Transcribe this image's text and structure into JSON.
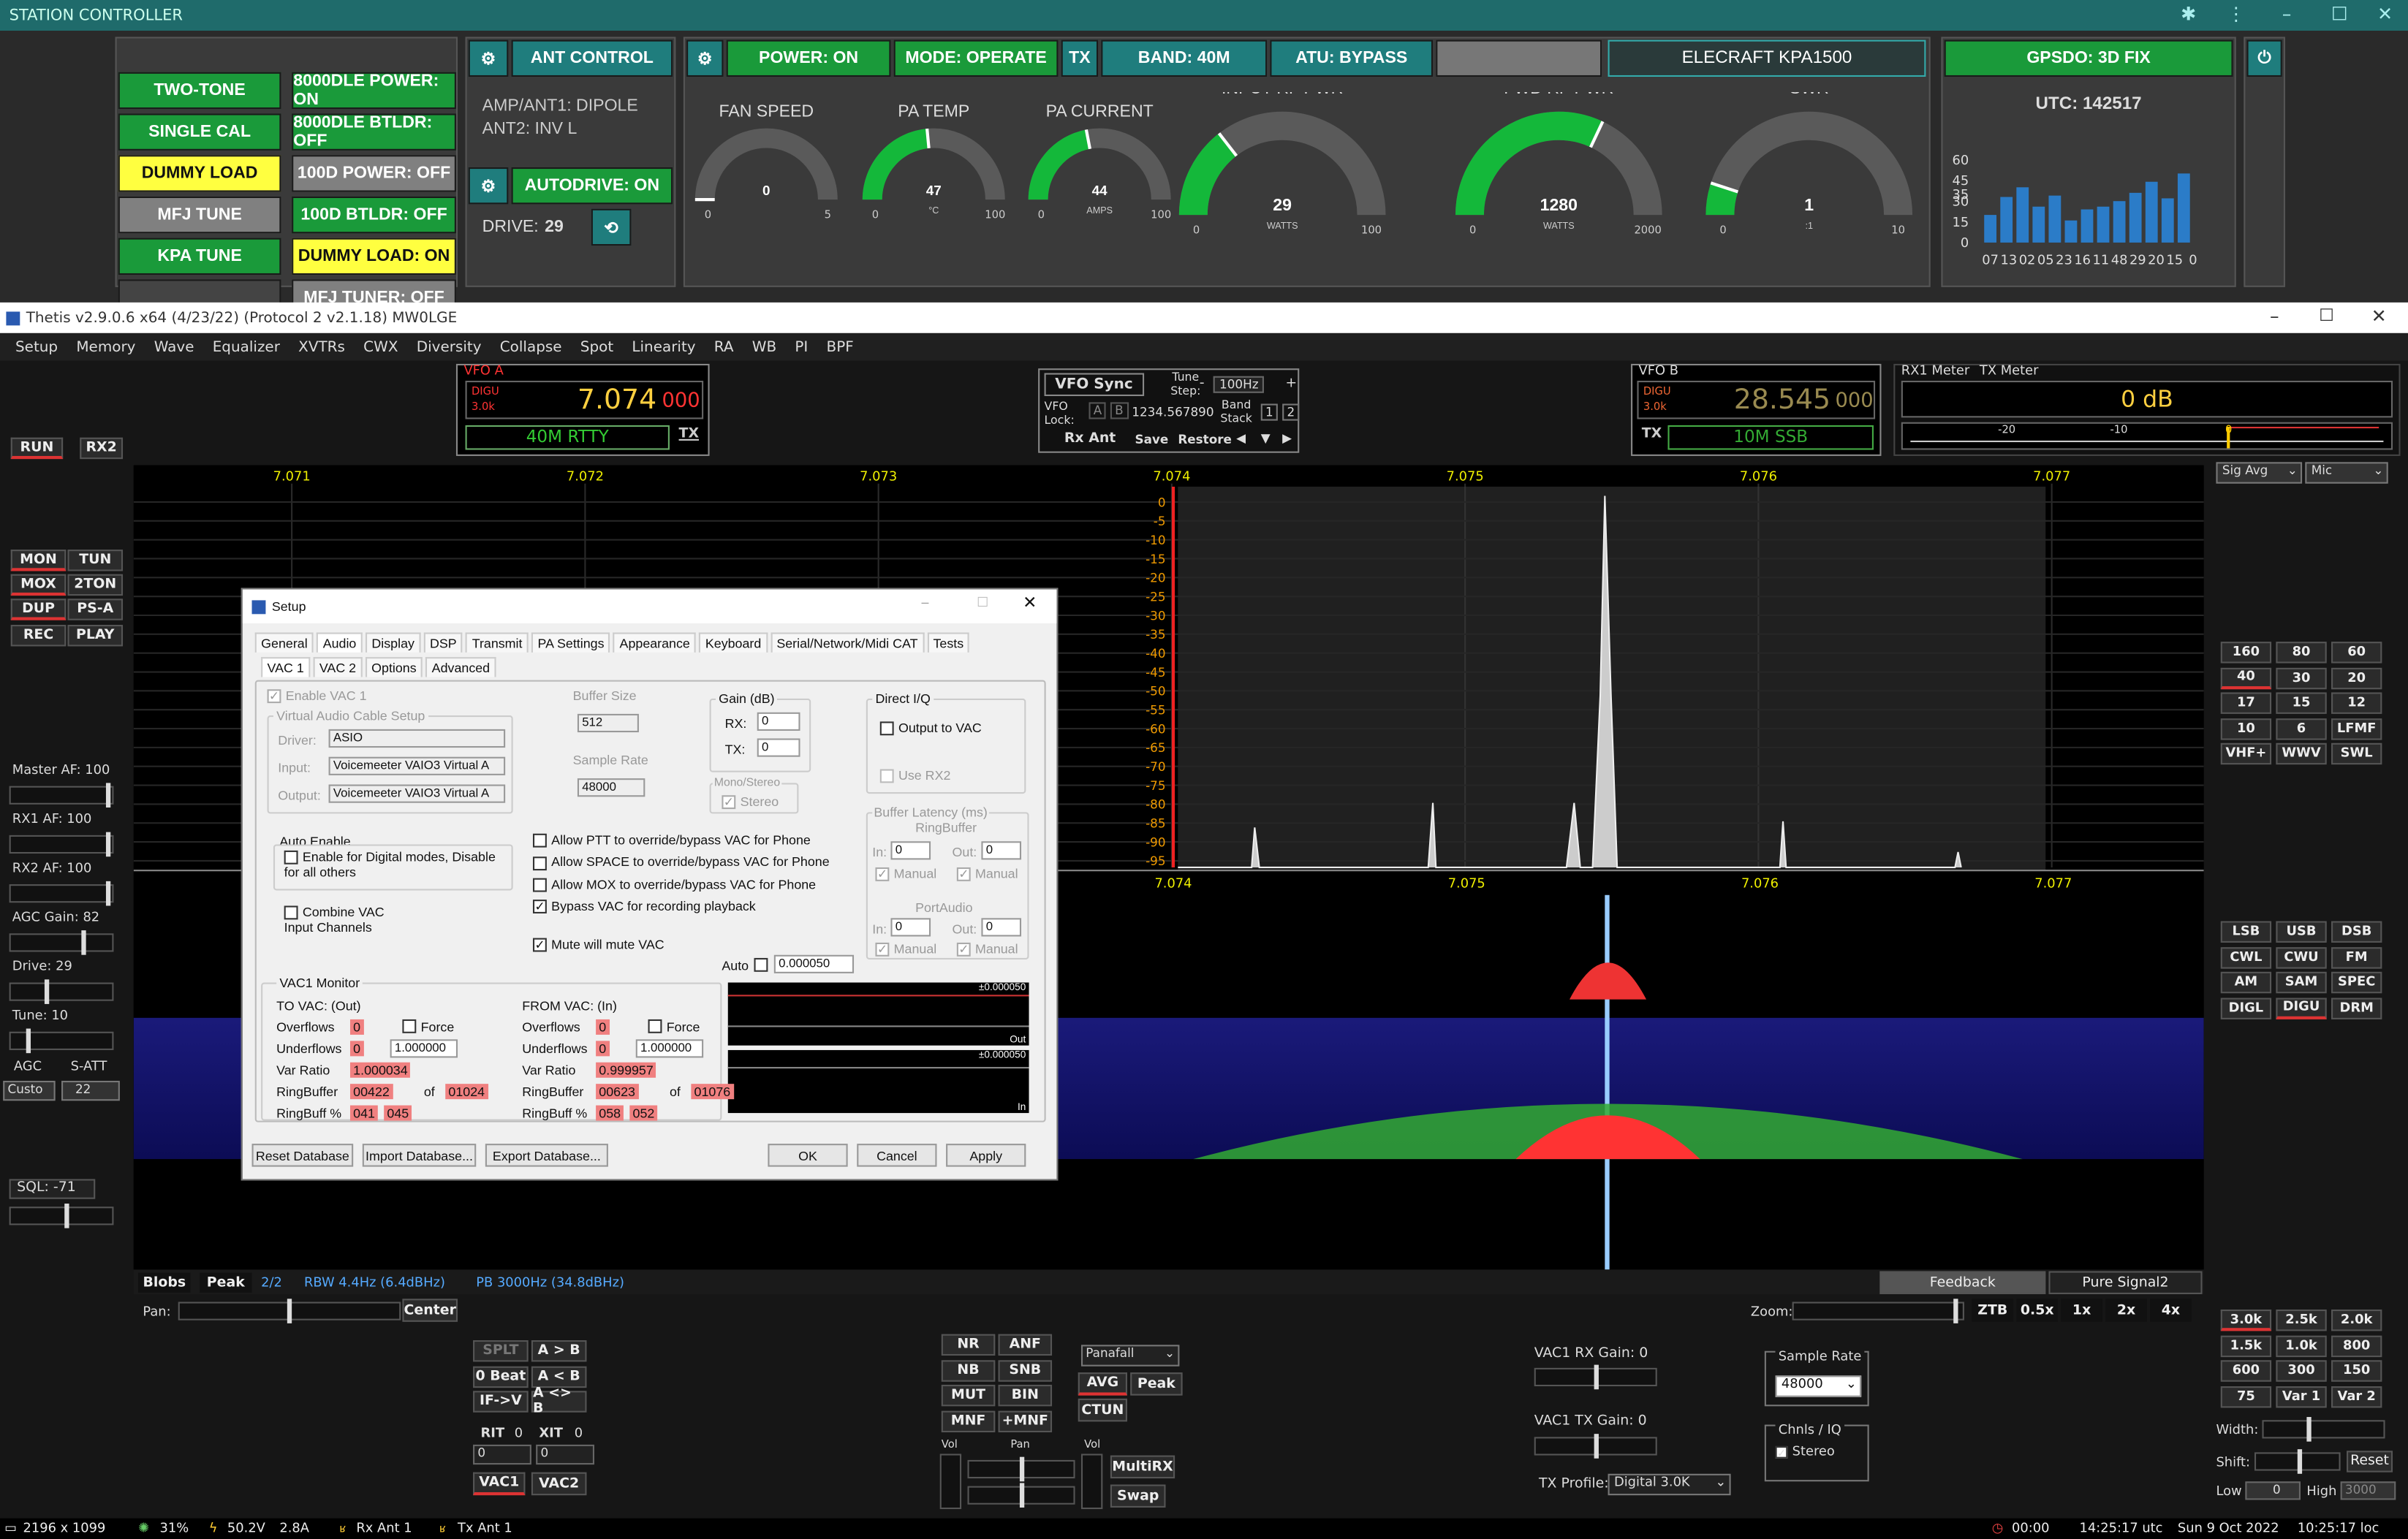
{
  "station_controller": {
    "title": "STATION CONTROLLER",
    "col1": [
      {
        "label": "TWO-TONE",
        "style": "green"
      },
      {
        "label": "SINGLE CAL",
        "style": "green"
      },
      {
        "label": "DUMMY LOAD",
        "style": "yellow"
      },
      {
        "label": "MFJ TUNE",
        "style": "grey"
      },
      {
        "label": "KPA TUNE",
        "style": "green"
      }
    ],
    "col2": [
      {
        "label": "8000DLE POWER: ON",
        "style": "green"
      },
      {
        "label": "8000DLE BTLDR: OFF",
        "style": "green"
      },
      {
        "label": "100D POWER: OFF",
        "style": "grey"
      },
      {
        "label": "100D BTLDR: OFF",
        "style": "green"
      },
      {
        "label": "DUMMY LOAD: ON",
        "style": "yellow"
      },
      {
        "label": "MFJ TUNER: OFF",
        "style": "grey"
      }
    ],
    "ant_control": "ANT CONTROL",
    "ant_lines": [
      "AMP/ANT1: DIPOLE",
      "ANT2: INV L"
    ],
    "autodrive": "AUTODRIVE: ON",
    "drive_label": "DRIVE:",
    "drive_value": "29",
    "top_status": [
      "POWER: ON",
      "MODE: OPERATE",
      "TX",
      "BAND: 40M",
      "ATU: BYPASS"
    ],
    "amp_name": "ELECRAFT KPA1500",
    "gpsdo": "GPSDO: 3D FIX",
    "utc": "UTC: 142517",
    "gauges": [
      {
        "title": "FAN SPEED",
        "value": "0",
        "min": "0",
        "max": "5",
        "unit": "",
        "frac": 0.0
      },
      {
        "title": "PA TEMP",
        "value": "47",
        "min": "0",
        "max": "100",
        "unit": "°C",
        "frac": 0.47
      },
      {
        "title": "PA CURRENT",
        "value": "44",
        "min": "0",
        "max": "100",
        "unit": "AMPS",
        "frac": 0.44
      },
      {
        "title": "INPUT RF PWR",
        "value": "29",
        "min": "0",
        "max": "100",
        "unit": "WATTS",
        "frac": 0.29
      },
      {
        "title": "FWD RF PWR",
        "value": "1280",
        "min": "0",
        "max": "2000",
        "unit": "WATTS",
        "frac": 0.64
      },
      {
        "title": "SWR",
        "value": "1",
        "min": "0",
        "max": "10",
        "unit": ":1",
        "frac": 0.1
      }
    ],
    "gps_chart": {
      "y_ticks": [
        "60",
        "45",
        "35",
        "30",
        "15",
        "0"
      ],
      "x_labels": [
        "07",
        "13",
        "02",
        "05",
        "23",
        "16",
        "11",
        "48",
        "29",
        "20",
        "15",
        "0"
      ],
      "values": [
        20,
        33,
        40,
        26,
        34,
        16,
        24,
        26,
        30,
        36,
        44,
        32,
        50
      ]
    }
  },
  "thetis": {
    "title": "Thetis v2.9.0.6 x64 (4/23/22) (Protocol 2 v2.1.18) MW0LGE",
    "menu": [
      "Setup",
      "Memory",
      "Wave",
      "Equalizer",
      "XVTRs",
      "CWX",
      "Diversity",
      "Collapse",
      "Spot",
      "Linearity",
      "RA",
      "WB",
      "PI",
      "BPF"
    ],
    "vfo_a": {
      "label": "VFO A",
      "mode": "DIGU",
      "bw": "3.0k",
      "freq": "7.074",
      "freq_sub": "000",
      "band": "40M RTTY",
      "tx": "TX"
    },
    "vfo_b": {
      "label": "VFO B",
      "mode": "DIGU",
      "bw": "3.0k",
      "freq": "28.545",
      "freq_sub": "000",
      "band": "10M SSB",
      "tx": "TX"
    },
    "vfo_sync": "VFO Sync",
    "tune_step_label": "Tune Step:",
    "tune_step": "100Hz",
    "vfo_lock": "VFO Lock:",
    "lock_value": "1234.567890",
    "band_stack": "Band Stack",
    "rx_ant": "Rx Ant",
    "save": "Save",
    "restore": "Restore",
    "rx1_meter": "RX1 Meter",
    "tx_meter": "TX Meter",
    "meter_value": "0 dB",
    "meter_ticks": [
      "-20",
      "-10",
      "0"
    ],
    "sig_avg": "Sig Avg",
    "mic": "Mic",
    "left_buttons": [
      "RUN",
      "RX2",
      "MON",
      "TUN",
      "MOX",
      "2TON",
      "DUP",
      "PS-A",
      "REC",
      "PLAY"
    ],
    "left_sliders": [
      {
        "label": "Master AF:  100"
      },
      {
        "label": "RX1 AF:  100"
      },
      {
        "label": "RX2 AF:  100"
      },
      {
        "label": "AGC Gain:  82"
      },
      {
        "label": "Drive:  29"
      },
      {
        "label": "Tune:  10"
      }
    ],
    "agc": "AGC",
    "s_att": "S-ATT",
    "agc_mode": "Custo",
    "s_att_value": "22",
    "sql": "SQL: -71",
    "freq_ticks_top": [
      "7.071",
      "7.072",
      "7.073",
      "7.074",
      "7.075",
      "7.076",
      "7.077"
    ],
    "db_ticks": [
      "0",
      "-5",
      "-10",
      "-15",
      "-20",
      "-25",
      "-30",
      "-35",
      "-40",
      "-45",
      "-50",
      "-55",
      "-60",
      "-65",
      "-70",
      "-75",
      "-80",
      "-85",
      "-90",
      "-95"
    ],
    "freq_ticks_mid": [
      "7.074",
      "7.075",
      "7.076",
      "7.077"
    ],
    "bands": [
      "160",
      "80",
      "60",
      "40",
      "30",
      "20",
      "17",
      "15",
      "12",
      "10",
      "6",
      "LFMF",
      "VHF+",
      "WWV",
      "SWL"
    ],
    "modes": [
      "LSB",
      "USB",
      "DSB",
      "CWL",
      "CWU",
      "FM",
      "AM",
      "SAM",
      "SPEC",
      "DIGL",
      "DIGU",
      "DRM"
    ],
    "filters": [
      "3.0k",
      "2.5k",
      "2.0k",
      "1.5k",
      "1.0k",
      "800",
      "600",
      "300",
      "150",
      "75",
      "Var 1",
      "Var 2"
    ],
    "blobs": "Blobs",
    "peak": "Peak",
    "page": "2/2",
    "rbw": "RBW 4.4Hz (6.4dBHz)",
    "pb": "PB 3000Hz (34.8dBHz)",
    "feedback": "Feedback",
    "pure_signal": "Pure Signal2",
    "pan": "Pan:",
    "center": "Center",
    "zoom": "Zoom:",
    "zoom_buttons": [
      "ZTB",
      "0.5x",
      "1x",
      "2x",
      "4x"
    ],
    "split_buttons": [
      "SPLT",
      "A > B",
      "0 Beat",
      "A < B",
      "IF->V",
      "A <> B"
    ],
    "rit": "RIT",
    "rit_v": "0",
    "xit": "XIT",
    "xit_v": "0",
    "rit_field": "0",
    "xit_field": "0",
    "vac1": "VAC1",
    "vac2": "VAC2",
    "dsp_buttons": [
      "NR",
      "ANF",
      "NB",
      "SNB",
      "MUT",
      "BIN",
      "MNF",
      "+MNF"
    ],
    "panafall": "Panafall",
    "avg": "AVG",
    "peak2": "Peak",
    "ctun": "CTUN",
    "vol": "Vol",
    "pan2": "Pan",
    "vol2": "Vol",
    "multirx": "MultiRX",
    "swap": "Swap",
    "vac1_rx_gain": "VAC1 RX Gain:  0",
    "vac1_tx_gain": "VAC1 TX Gain:  0",
    "tx_profile_label": "TX Profile:",
    "tx_profile": "Digital 3.0K",
    "sample_rate_label": "Sample Rate",
    "sample_rate": "48000",
    "chnls_label": "Chnls / IQ",
    "stereo": "Stereo",
    "width": "Width:",
    "shift": "Shift:",
    "reset": "Reset",
    "low": "Low",
    "low_v": "0",
    "high": "High",
    "high_v": "3000"
  },
  "setup": {
    "title": "Setup",
    "tabs": [
      "General",
      "Audio",
      "Display",
      "DSP",
      "Transmit",
      "PA Settings",
      "Appearance",
      "Keyboard",
      "Serial/Network/Midi CAT",
      "Tests"
    ],
    "subtabs": [
      "VAC 1",
      "VAC 2",
      "Options",
      "Advanced"
    ],
    "enable_vac1": "Enable VAC 1",
    "vac_setup": "Virtual Audio Cable Setup",
    "driver_label": "Driver:",
    "driver": "ASIO",
    "input_label": "Input:",
    "input": "Voicemeeter VAIO3 Virtual A",
    "output_label": "Output:",
    "output": "Voicemeeter VAIO3 Virtual A",
    "buffer_size_label": "Buffer Size",
    "buffer_size": "512",
    "sample_rate_label": "Sample Rate",
    "sample_rate": "48000",
    "gain_label": "Gain (dB)",
    "rx_label": "RX:",
    "rx_gain": "0",
    "tx_label": "TX:",
    "tx_gain": "0",
    "mono_stereo_label": "Mono/Stereo",
    "stereo": "Stereo",
    "direct_iq": "Direct I/Q",
    "output_to_vac": "Output to VAC",
    "use_rx2": "Use RX2",
    "auto_enable": "Auto Enable",
    "auto_enable_cb": "Enable for Digital modes, Disable for all others",
    "combine_vac": "Combine VAC Input Channels",
    "options": [
      {
        "label": "Allow PTT to override/bypass VAC for Phone",
        "checked": false
      },
      {
        "label": "Allow SPACE to override/bypass VAC for Phone",
        "checked": false
      },
      {
        "label": "Allow MOX to override/bypass VAC for Phone",
        "checked": false
      },
      {
        "label": "Bypass VAC for recording playback",
        "checked": true
      },
      {
        "label": "Mute will mute VAC",
        "checked": true
      }
    ],
    "buffer_latency": "Buffer Latency (ms)",
    "ringbuffer": "RingBuffer",
    "portaudio": "PortAudio",
    "in_label": "In:",
    "out_label": "Out:",
    "zero": "0",
    "manual": "Manual",
    "auto": "Auto",
    "auto_value": "0.000050",
    "monitor_title": "VAC1 Monitor",
    "to_vac": "TO VAC: (Out)",
    "from_vac": "FROM VAC: (In)",
    "force": "Force",
    "overflows": "Overflows",
    "underflows": "Underflows",
    "var_ratio": "Var Ratio",
    "ringbuffer2": "RingBuffer",
    "ringbuff_pct": "RingBuff %",
    "of": "of",
    "to": {
      "overflows": "0",
      "underflows": "0",
      "force_val": "1.000000",
      "var_ratio": "1.000034",
      "rb_a": "00422",
      "rb_b": "01024",
      "pct_a": "041",
      "pct_b": "045"
    },
    "from": {
      "overflows": "0",
      "underflows": "0",
      "force_val": "1.000000",
      "var_ratio": "0.999957",
      "rb_a": "00623",
      "rb_b": "01076",
      "pct_a": "058",
      "pct_b": "052"
    },
    "scope1_top": "±0.000050",
    "scope1_bottom": "Out",
    "scope2_top": "±0.000050",
    "scope2_bottom": "In",
    "reset_db": "Reset Database",
    "import_db": "Import Database...",
    "export_db": "Export Database...",
    "ok": "OK",
    "cancel": "Cancel",
    "apply": "Apply"
  },
  "statusbar": {
    "resolution": "2196 x 1099",
    "cpu": "31%",
    "volts": "50.2V",
    "amps": "2.8A",
    "rx_ant": "Rx Ant 1",
    "tx_ant": "Tx Ant 1",
    "timer": "00:00",
    "utc": "14:25:17 utc",
    "date": "Sun 9 Oct 2022",
    "local": "10:25:17 loc"
  }
}
